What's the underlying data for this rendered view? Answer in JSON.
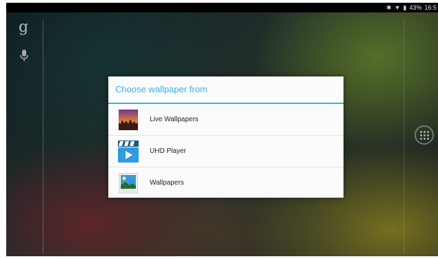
{
  "status_bar": {
    "battery": "43%",
    "time": "16:5",
    "icons": [
      "bluetooth-icon",
      "wifi-icon",
      "battery-icon"
    ]
  },
  "home": {
    "google_glyph": "g",
    "icons": [
      "google-search-icon",
      "mic-icon",
      "all-apps-icon"
    ]
  },
  "dialog": {
    "title": "Choose wallpaper from",
    "items": [
      {
        "label": "Live Wallpapers",
        "icon": "live-wallpapers-icon"
      },
      {
        "label": "UHD Player",
        "icon": "uhd-player-icon"
      },
      {
        "label": "Wallpapers",
        "icon": "wallpapers-icon"
      }
    ]
  },
  "colors": {
    "accent": "#33b5e5",
    "status_bar": "#000000",
    "dialog_bg": "#fbfbfb"
  }
}
